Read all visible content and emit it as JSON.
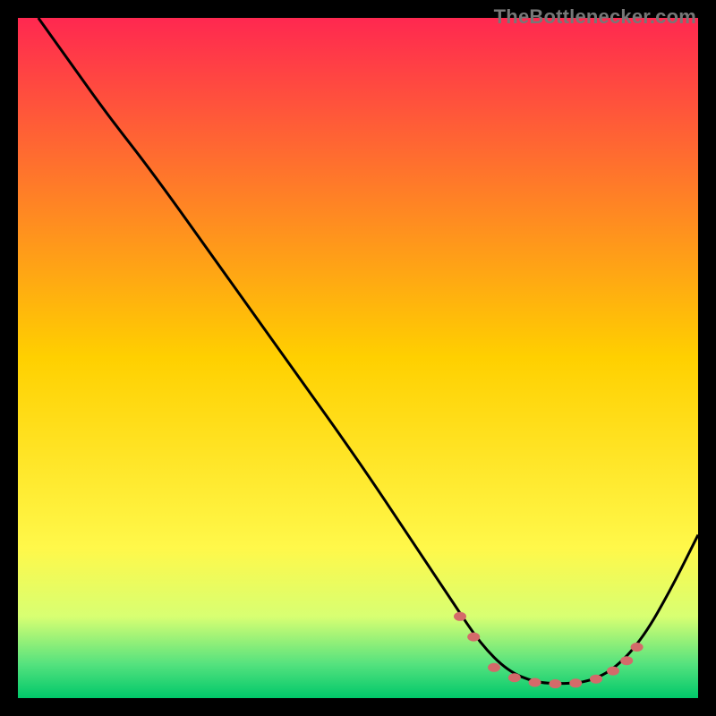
{
  "watermark": "TheBottlenecker.com",
  "chart_data": {
    "type": "line",
    "title": "",
    "xlabel": "",
    "ylabel": "",
    "xlim": [
      0,
      100
    ],
    "ylim": [
      0,
      100
    ],
    "background_gradient": {
      "stops": [
        {
          "pct": 0,
          "color": "#ff2850"
        },
        {
          "pct": 50,
          "color": "#ffd000"
        },
        {
          "pct": 78,
          "color": "#fff84a"
        },
        {
          "pct": 88,
          "color": "#d8ff72"
        },
        {
          "pct": 95,
          "color": "#55e27e"
        },
        {
          "pct": 100,
          "color": "#00c86a"
        }
      ]
    },
    "curve": [
      {
        "x": 3,
        "y": 100
      },
      {
        "x": 8,
        "y": 93
      },
      {
        "x": 13,
        "y": 86
      },
      {
        "x": 20,
        "y": 77
      },
      {
        "x": 30,
        "y": 63
      },
      {
        "x": 40,
        "y": 49
      },
      {
        "x": 50,
        "y": 35
      },
      {
        "x": 58,
        "y": 23
      },
      {
        "x": 64,
        "y": 14
      },
      {
        "x": 68,
        "y": 8
      },
      {
        "x": 72,
        "y": 4
      },
      {
        "x": 76,
        "y": 2.3
      },
      {
        "x": 80,
        "y": 2.1
      },
      {
        "x": 84,
        "y": 2.4
      },
      {
        "x": 88,
        "y": 4.5
      },
      {
        "x": 92,
        "y": 9
      },
      {
        "x": 96,
        "y": 16
      },
      {
        "x": 100,
        "y": 24
      }
    ],
    "markers": [
      {
        "x": 65,
        "y": 12
      },
      {
        "x": 67,
        "y": 9
      },
      {
        "x": 70,
        "y": 4.5
      },
      {
        "x": 73,
        "y": 3
      },
      {
        "x": 76,
        "y": 2.3
      },
      {
        "x": 79,
        "y": 2.1
      },
      {
        "x": 82,
        "y": 2.2
      },
      {
        "x": 85,
        "y": 2.8
      },
      {
        "x": 87.5,
        "y": 4
      },
      {
        "x": 89.5,
        "y": 5.5
      },
      {
        "x": 91,
        "y": 7.5
      }
    ],
    "marker_style": {
      "fill": "#d46a6a",
      "rx": 7,
      "ry": 5
    }
  }
}
